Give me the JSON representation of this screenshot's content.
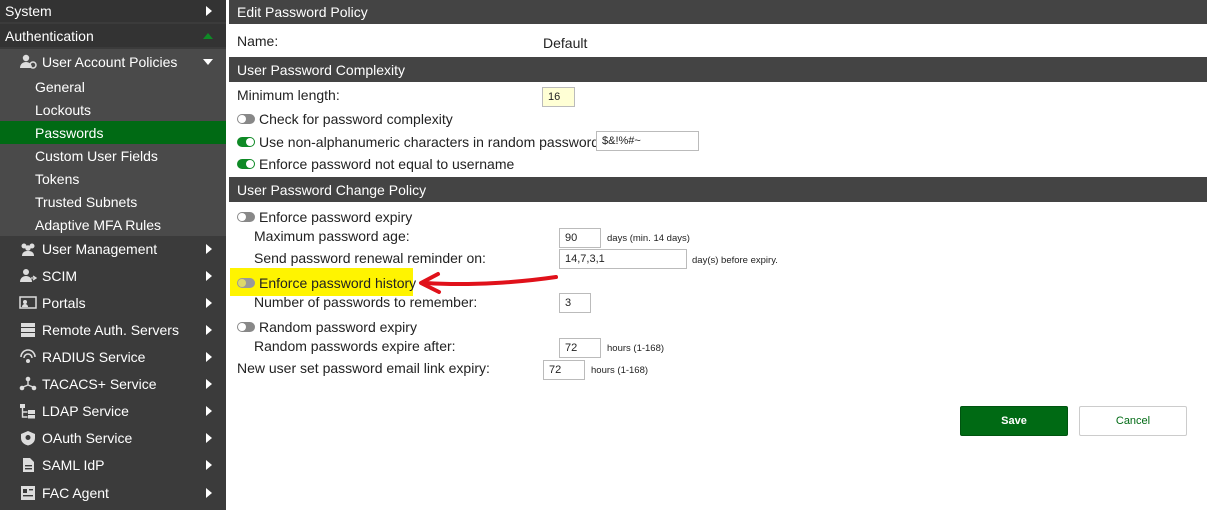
{
  "sidebar": {
    "system": "System",
    "authentication": "Authentication",
    "user_account_policies": "User Account Policies",
    "sub_items": [
      "General",
      "Lockouts",
      "Passwords",
      "Custom User Fields",
      "Tokens",
      "Trusted Subnets",
      "Adaptive MFA Rules"
    ],
    "active_sub": "Passwords",
    "main_items": [
      {
        "label": "User Management",
        "icon": "users-icon"
      },
      {
        "label": "SCIM",
        "icon": "scim-icon"
      },
      {
        "label": "Portals",
        "icon": "portals-icon"
      },
      {
        "label": "Remote Auth. Servers",
        "icon": "servers-icon"
      },
      {
        "label": "RADIUS Service",
        "icon": "radius-icon"
      },
      {
        "label": "TACACS+ Service",
        "icon": "tacacs-icon"
      },
      {
        "label": "LDAP Service",
        "icon": "ldap-icon"
      },
      {
        "label": "OAuth Service",
        "icon": "oauth-icon"
      },
      {
        "label": "SAML IdP",
        "icon": "saml-icon"
      },
      {
        "label": "FAC Agent",
        "icon": "agent-icon"
      }
    ]
  },
  "form": {
    "header": "Edit Password Policy",
    "name_label": "Name:",
    "name_value": "Default",
    "complexity": {
      "header": "User Password Complexity",
      "min_length_label": "Minimum length:",
      "min_length_value": "16",
      "check_complexity_label": "Check for password complexity",
      "check_complexity_on": false,
      "non_alnum_label": "Use non-alphanumeric characters in random passwords",
      "non_alnum_on": true,
      "non_alnum_value": "$&!%#~",
      "not_username_label": "Enforce password not equal to username",
      "not_username_on": true
    },
    "change_policy": {
      "header": "User Password Change Policy",
      "expiry_label": "Enforce password expiry",
      "expiry_on": false,
      "max_age_label": "Maximum password age:",
      "max_age_value": "90",
      "max_age_hint": "days (min. 14 days)",
      "reminder_label": "Send password renewal reminder on:",
      "reminder_value": "14,7,3,1",
      "reminder_hint": "day(s) before expiry.",
      "history_label": "Enforce password history",
      "history_on": false,
      "history_count_label": "Number of passwords to remember:",
      "history_count_value": "3",
      "random_expiry_label": "Random password expiry",
      "random_expiry_on": false,
      "random_expire_after_label": "Random passwords expire after:",
      "random_expire_after_value": "72",
      "random_expire_after_hint": "hours (1-168)",
      "email_link_label": "New user set password email link expiry:",
      "email_link_value": "72",
      "email_link_hint": "hours (1-168)"
    },
    "save_label": "Save",
    "cancel_label": "Cancel"
  },
  "annotation": {
    "highlight_color": "#fff400",
    "arrow_color": "#e0111a"
  }
}
